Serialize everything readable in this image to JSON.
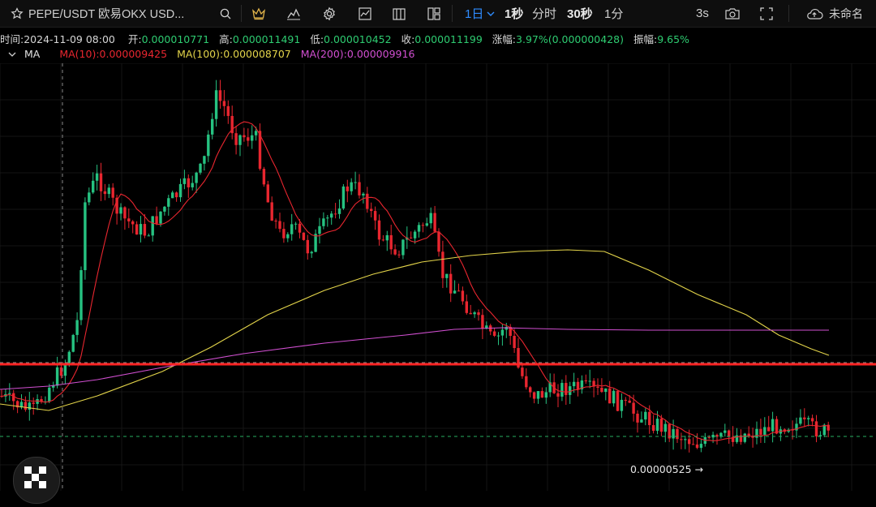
{
  "toolbar": {
    "symbol": "PEPE/USDT 欧易OKX USD...",
    "interval_active": "1日",
    "intervals": [
      "1秒",
      "分时",
      "30秒",
      "1分"
    ],
    "replay_speed": "3s",
    "layout_name": "未命名",
    "icons": [
      "star-icon",
      "search-icon",
      "crown-icon",
      "indicators-icon",
      "settings-icon",
      "chart-type-icon",
      "template-icon",
      "layout-icon",
      "camera-icon",
      "fullscreen-icon",
      "cloud-icon"
    ]
  },
  "ohlc": {
    "time_label": "时间:",
    "time": "2024-11-09 08:00",
    "open_label": "开:",
    "open": "0.000010771",
    "high_label": "高:",
    "high": "0.000011491",
    "low_label": "低:",
    "low": "0.000010452",
    "close_label": "收:",
    "close": "0.000011199",
    "change_label": "涨幅:",
    "change": "3.97%(0.000000428)",
    "amplitude_label": "振幅:",
    "amplitude": "9.65%"
  },
  "indicator": {
    "name": "MA",
    "ma10": "MA(10):0.000009425",
    "ma100": "MA(100):0.000008707",
    "ma200": "MA(200):0.000009916"
  },
  "price_marker": "0.00000525 →",
  "colors": {
    "up": "#26c281",
    "down": "#e8262f",
    "ma10": "#e8262f",
    "ma100": "#e3d44a",
    "ma200": "#d14fd1",
    "active": "#2f8cff",
    "value": "#2ecc71"
  }
}
